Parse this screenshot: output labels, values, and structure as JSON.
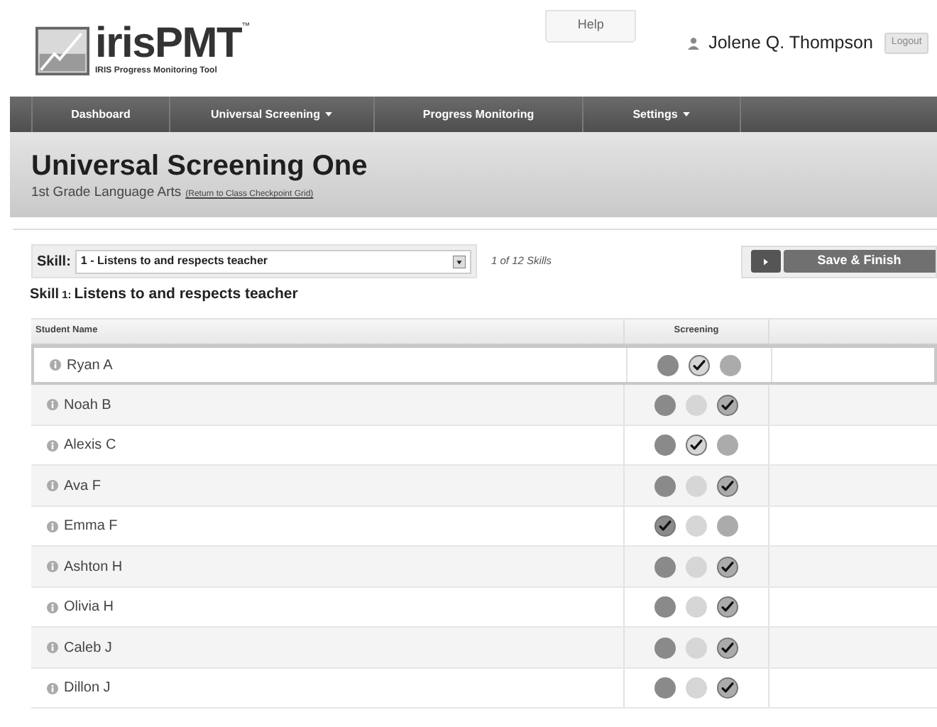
{
  "logo": {
    "name": "irisPMT",
    "trademark": "™",
    "tagline": "IRIS Progress Monitoring Tool"
  },
  "help": "Help",
  "user": {
    "name": "Jolene Q. Thompson",
    "logout": "Logout"
  },
  "nav": [
    {
      "label": "Dashboard",
      "dropdown": false
    },
    {
      "label": "Universal Screening",
      "dropdown": true
    },
    {
      "label": "Progress Monitoring",
      "dropdown": false
    },
    {
      "label": "Settings",
      "dropdown": true
    }
  ],
  "title": "Universal Screening One",
  "subtitle": "1st Grade Language Arts",
  "return_link": "(Return to Class Checkpoint Grid)",
  "skill_select": {
    "label": "Skill:",
    "value": "1 - Listens to and respects teacher",
    "count": "1 of 12 Skills"
  },
  "save_button": "Save & Finish",
  "skill_heading": {
    "prefix": "Skill",
    "number": "1:",
    "text": "Listens to and respects teacher"
  },
  "table": {
    "columns": [
      "Student Name",
      "Screening"
    ],
    "rows": [
      {
        "name": "Ryan A",
        "highlighted": true,
        "options": [
          {
            "color": "#8a8a8a",
            "selected": false
          },
          {
            "color": "#d6d6d6",
            "selected": true
          },
          {
            "color": "#ababab",
            "selected": false
          }
        ]
      },
      {
        "name": "Noah B",
        "highlighted": false,
        "options": [
          {
            "color": "#8a8a8a",
            "selected": false
          },
          {
            "color": "#d6d6d6",
            "selected": false
          },
          {
            "color": "#ababab",
            "selected": true
          }
        ]
      },
      {
        "name": "Alexis C",
        "highlighted": false,
        "options": [
          {
            "color": "#8a8a8a",
            "selected": false
          },
          {
            "color": "#d6d6d6",
            "selected": true
          },
          {
            "color": "#ababab",
            "selected": false
          }
        ]
      },
      {
        "name": "Ava F",
        "highlighted": false,
        "options": [
          {
            "color": "#8a8a8a",
            "selected": false
          },
          {
            "color": "#d6d6d6",
            "selected": false
          },
          {
            "color": "#ababab",
            "selected": true
          }
        ]
      },
      {
        "name": "Emma F",
        "highlighted": false,
        "options": [
          {
            "color": "#8a8a8a",
            "selected": true
          },
          {
            "color": "#d6d6d6",
            "selected": false
          },
          {
            "color": "#ababab",
            "selected": false
          }
        ]
      },
      {
        "name": "Ashton H",
        "highlighted": false,
        "options": [
          {
            "color": "#8a8a8a",
            "selected": false
          },
          {
            "color": "#d6d6d6",
            "selected": false
          },
          {
            "color": "#ababab",
            "selected": true
          }
        ]
      },
      {
        "name": "Olivia H",
        "highlighted": false,
        "options": [
          {
            "color": "#8a8a8a",
            "selected": false
          },
          {
            "color": "#d6d6d6",
            "selected": false
          },
          {
            "color": "#ababab",
            "selected": true
          }
        ]
      },
      {
        "name": "Caleb J",
        "highlighted": false,
        "options": [
          {
            "color": "#8a8a8a",
            "selected": false
          },
          {
            "color": "#d6d6d6",
            "selected": false
          },
          {
            "color": "#ababab",
            "selected": true
          }
        ]
      },
      {
        "name": "Dillon J",
        "highlighted": false,
        "options": [
          {
            "color": "#8a8a8a",
            "selected": false
          },
          {
            "color": "#d6d6d6",
            "selected": false
          },
          {
            "color": "#ababab",
            "selected": true
          }
        ]
      }
    ]
  }
}
